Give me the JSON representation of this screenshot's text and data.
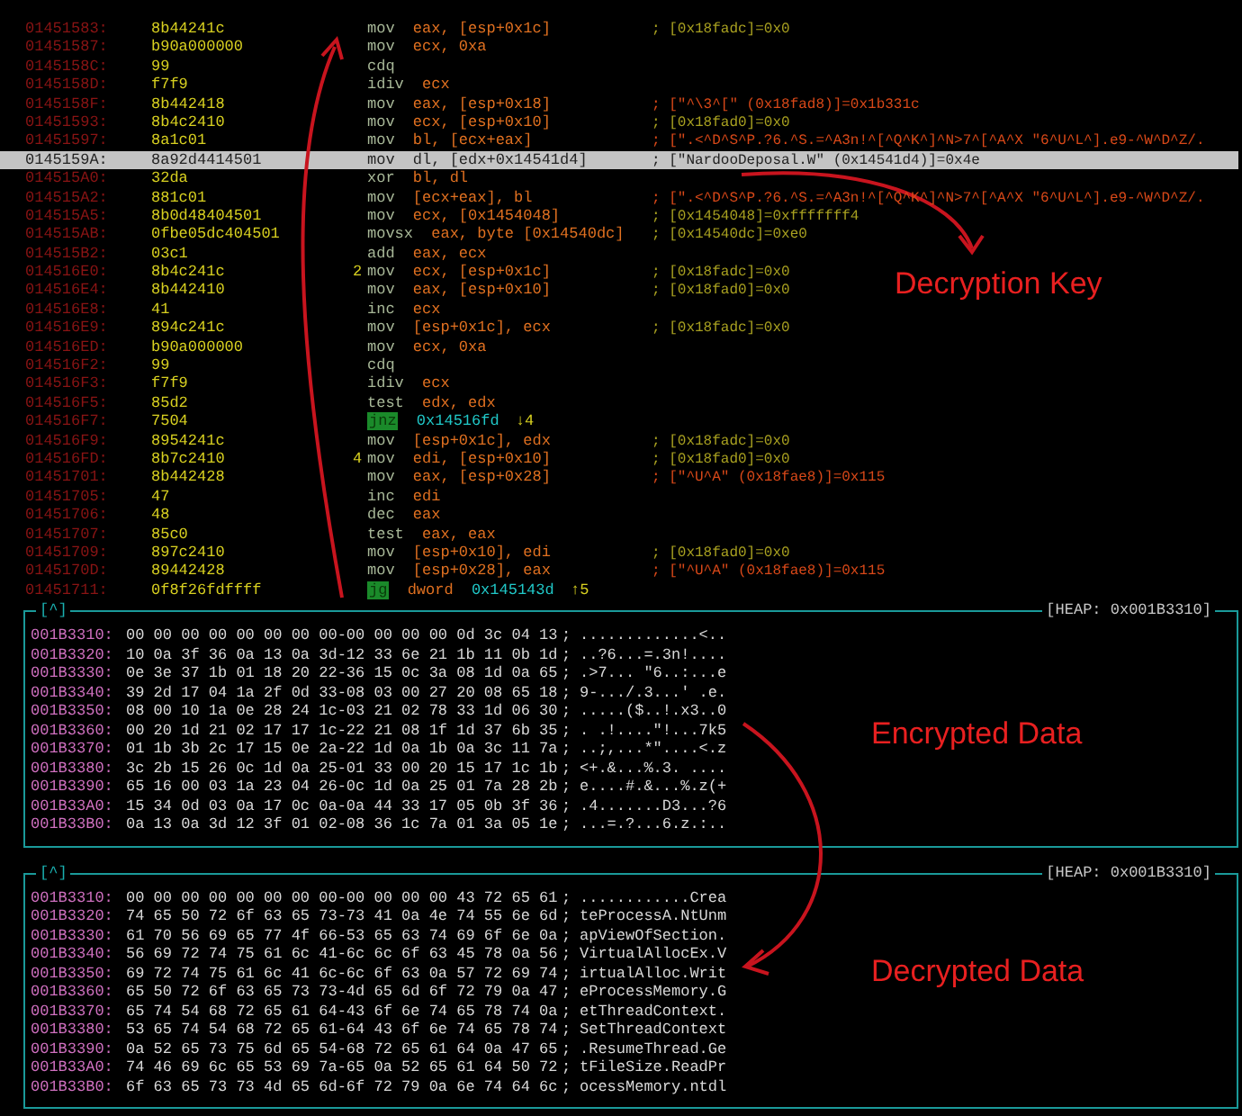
{
  "disassembly": [
    {
      "kind": "plain",
      "address": "01451583:",
      "bytes": "8b44241c",
      "mnemonic": "mov",
      "operands": "eax, [esp+0x1c]",
      "comment": {
        "kind": "value",
        "text": "; [0x18fadc]=0x0"
      },
      "selected": false
    },
    {
      "kind": "plain",
      "address": "01451587:",
      "bytes": "b90a000000",
      "mnemonic": "mov",
      "operands": "ecx, 0xa",
      "selected": false
    },
    {
      "kind": "plain",
      "address": "0145158C:",
      "bytes": "99",
      "mnemonic": "cdq",
      "selected": false
    },
    {
      "kind": "plain",
      "address": "0145158D:",
      "bytes": "f7f9",
      "mnemonic": "idiv",
      "operands": "ecx",
      "selected": false
    },
    {
      "kind": "plain",
      "address": "0145158F:",
      "bytes": "8b442418",
      "mnemonic": "mov",
      "operands": "eax, [esp+0x18]",
      "comment": {
        "kind": "string",
        "text": "; [\"^\\3^[\" (0x18fad8)]=0x1b331c"
      },
      "selected": false
    },
    {
      "kind": "plain",
      "address": "01451593:",
      "bytes": "8b4c2410",
      "mnemonic": "mov",
      "operands": "ecx, [esp+0x10]",
      "comment": {
        "kind": "value",
        "text": "; [0x18fad0]=0x0"
      },
      "selected": false
    },
    {
      "kind": "plain",
      "address": "01451597:",
      "bytes": "8a1c01",
      "mnemonic": "mov",
      "operands": "bl, [ecx+eax]",
      "comment": {
        "kind": "string",
        "text": "; [\".<^D^S^P.?6.^S.=^A3n!^[^Q^K^]^N>7^[^A^X \"6^U^L^].e9-^W^D^Z/."
      },
      "selected": false
    },
    {
      "kind": "plain",
      "address": "0145159A:",
      "bytes": "8a92d4414501",
      "mnemonic": "mov",
      "operands": "dl, [edx+0x14541d4]",
      "comment": {
        "kind": "string",
        "text": "; [\"NardooDeposal.W\" (0x14541d4)]=0x4e"
      },
      "selected": true
    },
    {
      "kind": "plain",
      "address": "014515A0:",
      "bytes": "32da",
      "mnemonic": "xor",
      "operands": "bl, dl",
      "selected": false
    },
    {
      "kind": "plain",
      "address": "014515A2:",
      "bytes": "881c01",
      "mnemonic": "mov",
      "operands": "[ecx+eax], bl",
      "comment": {
        "kind": "string",
        "text": "; [\".<^D^S^P.?6.^S.=^A3n!^[^Q^K^]^N>7^[^A^X \"6^U^L^].e9-^W^D^Z/."
      },
      "selected": false
    },
    {
      "kind": "plain",
      "address": "014515A5:",
      "bytes": "8b0d48404501",
      "mnemonic": "mov",
      "operands": "ecx, [0x1454048]",
      "comment": {
        "kind": "value",
        "text": "; [0x1454048]=0xfffffff4"
      },
      "selected": false
    },
    {
      "kind": "plain",
      "address": "014515AB:",
      "bytes": "0fbe05dc404501",
      "mnemonic": "movsx",
      "operands": "eax, byte [0x14540dc]",
      "comment": {
        "kind": "value",
        "text": "; [0x14540dc]=0xe0"
      },
      "selected": false
    },
    {
      "kind": "plain",
      "address": "014515B2:",
      "bytes": "03c1",
      "mnemonic": "add",
      "operands": "eax, ecx",
      "selected": false
    },
    {
      "kind": "plain",
      "address": "014516E0:",
      "bytes": "8b4c241c",
      "label": "2",
      "mnemonic": "mov",
      "operands": "ecx, [esp+0x1c]",
      "comment": {
        "kind": "value",
        "text": "; [0x18fadc]=0x0"
      },
      "selected": false
    },
    {
      "kind": "plain",
      "address": "014516E4:",
      "bytes": "8b442410",
      "mnemonic": "mov",
      "operands": "eax, [esp+0x10]",
      "comment": {
        "kind": "value",
        "text": "; [0x18fad0]=0x0"
      },
      "selected": false
    },
    {
      "kind": "plain",
      "address": "014516E8:",
      "bytes": "41",
      "mnemonic": "inc",
      "operands": "ecx",
      "selected": false
    },
    {
      "kind": "plain",
      "address": "014516E9:",
      "bytes": "894c241c",
      "mnemonic": "mov",
      "operands": "[esp+0x1c], ecx",
      "comment": {
        "kind": "value",
        "text": "; [0x18fadc]=0x0"
      },
      "selected": false
    },
    {
      "kind": "plain",
      "address": "014516ED:",
      "bytes": "b90a000000",
      "mnemonic": "mov",
      "operands": "ecx, 0xa",
      "selected": false
    },
    {
      "kind": "plain",
      "address": "014516F2:",
      "bytes": "99",
      "mnemonic": "cdq",
      "selected": false
    },
    {
      "kind": "plain",
      "address": "014516F3:",
      "bytes": "f7f9",
      "mnemonic": "idiv",
      "operands": "ecx",
      "selected": false
    },
    {
      "kind": "plain",
      "address": "014516F5:",
      "bytes": "85d2",
      "mnemonic": "test",
      "operands": "edx, edx",
      "selected": false
    },
    {
      "kind": "jump",
      "address": "014516F7:",
      "bytes": "7504",
      "mnemonic": "jnz",
      "target": "0x14516fd",
      "ref": "↓4",
      "selected": false
    },
    {
      "kind": "plain",
      "address": "014516F9:",
      "bytes": "8954241c",
      "mnemonic": "mov",
      "operands": "[esp+0x1c], edx",
      "comment": {
        "kind": "value",
        "text": "; [0x18fadc]=0x0"
      },
      "selected": false
    },
    {
      "kind": "plain",
      "address": "014516FD:",
      "bytes": "8b7c2410",
      "label": "4",
      "mnemonic": "mov",
      "operands": "edi, [esp+0x10]",
      "comment": {
        "kind": "value",
        "text": "; [0x18fad0]=0x0"
      },
      "selected": false
    },
    {
      "kind": "plain",
      "address": "01451701:",
      "bytes": "8b442428",
      "mnemonic": "mov",
      "operands": "eax, [esp+0x28]",
      "comment": {
        "kind": "string",
        "text": "; [\"^U^A\" (0x18fae8)]=0x115"
      },
      "selected": false
    },
    {
      "kind": "plain",
      "address": "01451705:",
      "bytes": "47",
      "mnemonic": "inc",
      "operands": "edi",
      "selected": false
    },
    {
      "kind": "plain",
      "address": "01451706:",
      "bytes": "48",
      "mnemonic": "dec",
      "operands": "eax",
      "selected": false
    },
    {
      "kind": "plain",
      "address": "01451707:",
      "bytes": "85c0",
      "mnemonic": "test",
      "operands": "eax, eax",
      "selected": false
    },
    {
      "kind": "plain",
      "address": "01451709:",
      "bytes": "897c2410",
      "mnemonic": "mov",
      "operands": "[esp+0x10], edi",
      "comment": {
        "kind": "value",
        "text": "; [0x18fad0]=0x0"
      },
      "selected": false
    },
    {
      "kind": "plain",
      "address": "0145170D:",
      "bytes": "89442428",
      "mnemonic": "mov",
      "operands": "[esp+0x28], eax",
      "comment": {
        "kind": "string",
        "text": "; [\"^U^A\" (0x18fae8)]=0x115"
      },
      "selected": false
    },
    {
      "kind": "jump",
      "address": "01451711:",
      "bytes": "0f8f26fdffff",
      "mnemonic": "jg",
      "operands": "dword",
      "target": "0x145143d",
      "ref": "↑5",
      "selected": false
    }
  ],
  "hex_panels": [
    {
      "title": "[^]",
      "heap": "[HEAP: 0x001B3310]",
      "rows": [
        {
          "address": "001B3310:",
          "hex": "00 00 00 00 00 00 00 00-00 00 00 00 0d 3c 04 13",
          "separator": ";",
          "ascii": ".............<.."
        },
        {
          "address": "001B3320:",
          "hex": "10 0a 3f 36 0a 13 0a 3d-12 33 6e 21 1b 11 0b 1d",
          "separator": ";",
          "ascii": "..?6...=.3n!...."
        },
        {
          "address": "001B3330:",
          "hex": "0e 3e 37 1b 01 18 20 22-36 15 0c 3a 08 1d 0a 65",
          "separator": ";",
          "ascii": ".>7... \"6..:...e"
        },
        {
          "address": "001B3340:",
          "hex": "39 2d 17 04 1a 2f 0d 33-08 03 00 27 20 08 65 18",
          "separator": ";",
          "ascii": "9-.../.3...' .e."
        },
        {
          "address": "001B3350:",
          "hex": "08 00 10 1a 0e 28 24 1c-03 21 02 78 33 1d 06 30",
          "separator": ";",
          "ascii": ".....($..!.x3..0"
        },
        {
          "address": "001B3360:",
          "hex": "00 20 1d 21 02 17 17 1c-22 21 08 1f 1d 37 6b 35",
          "separator": ";",
          "ascii": ". .!....\"!...7k5"
        },
        {
          "address": "001B3370:",
          "hex": "01 1b 3b 2c 17 15 0e 2a-22 1d 0a 1b 0a 3c 11 7a",
          "separator": ";",
          "ascii": "..;,...*\"....<.z"
        },
        {
          "address": "001B3380:",
          "hex": "3c 2b 15 26 0c 1d 0a 25-01 33 00 20 15 17 1c 1b",
          "separator": ";",
          "ascii": "<+.&...%.3. ...."
        },
        {
          "address": "001B3390:",
          "hex": "65 16 00 03 1a 23 04 26-0c 1d 0a 25 01 7a 28 2b",
          "separator": ";",
          "ascii": "e....#.&...%.z(+"
        },
        {
          "address": "001B33A0:",
          "hex": "15 34 0d 03 0a 17 0c 0a-0a 44 33 17 05 0b 3f 36",
          "separator": ";",
          "ascii": ".4.......D3...?6"
        },
        {
          "address": "001B33B0:",
          "hex": "0a 13 0a 3d 12 3f 01 02-08 36 1c 7a 01 3a 05 1e",
          "separator": ";",
          "ascii": "...=.?...6.z.:.."
        }
      ]
    },
    {
      "title": "[^]",
      "heap": "[HEAP: 0x001B3310]",
      "rows": [
        {
          "address": "001B3310:",
          "hex": "00 00 00 00 00 00 00 00-00 00 00 00 43 72 65 61",
          "separator": ";",
          "ascii": "............Crea"
        },
        {
          "address": "001B3320:",
          "hex": "74 65 50 72 6f 63 65 73-73 41 0a 4e 74 55 6e 6d",
          "separator": ";",
          "ascii": "teProcessA.NtUnm"
        },
        {
          "address": "001B3330:",
          "hex": "61 70 56 69 65 77 4f 66-53 65 63 74 69 6f 6e 0a",
          "separator": ";",
          "ascii": "apViewOfSection."
        },
        {
          "address": "001B3340:",
          "hex": "56 69 72 74 75 61 6c 41-6c 6c 6f 63 45 78 0a 56",
          "separator": ";",
          "ascii": "VirtualAllocEx.V"
        },
        {
          "address": "001B3350:",
          "hex": "69 72 74 75 61 6c 41 6c-6c 6f 63 0a 57 72 69 74",
          "separator": ";",
          "ascii": "irtualAlloc.Writ"
        },
        {
          "address": "001B3360:",
          "hex": "65 50 72 6f 63 65 73 73-4d 65 6d 6f 72 79 0a 47",
          "separator": ";",
          "ascii": "eProcessMemory.G"
        },
        {
          "address": "001B3370:",
          "hex": "65 74 54 68 72 65 61 64-43 6f 6e 74 65 78 74 0a",
          "separator": ";",
          "ascii": "etThreadContext."
        },
        {
          "address": "001B3380:",
          "hex": "53 65 74 54 68 72 65 61-64 43 6f 6e 74 65 78 74",
          "separator": ";",
          "ascii": "SetThreadContext"
        },
        {
          "address": "001B3390:",
          "hex": "0a 52 65 73 75 6d 65 54-68 72 65 61 64 0a 47 65",
          "separator": ";",
          "ascii": ".ResumeThread.Ge"
        },
        {
          "address": "001B33A0:",
          "hex": "74 46 69 6c 65 53 69 7a-65 0a 52 65 61 64 50 72",
          "separator": ";",
          "ascii": "tFileSize.ReadPr"
        },
        {
          "address": "001B33B0:",
          "hex": "6f 63 65 73 73 4d 65 6d-6f 72 79 0a 6e 74 64 6c",
          "separator": ";",
          "ascii": "ocessMemory.ntdl"
        }
      ]
    }
  ],
  "annotations": [
    {
      "text": "Decryption Key"
    },
    {
      "text": "Encrypted Data"
    },
    {
      "text": "Decrypted Data"
    }
  ]
}
